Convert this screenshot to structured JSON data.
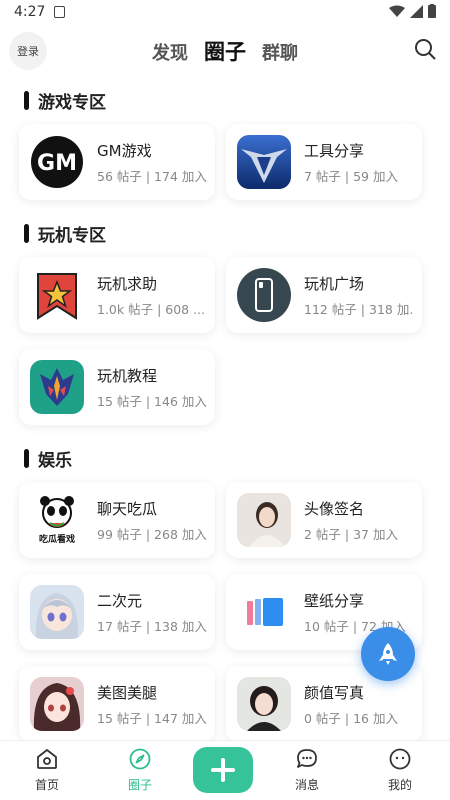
{
  "status": {
    "time": "4:27"
  },
  "header": {
    "login_label": "登录",
    "tabs": [
      "发现",
      "圈子",
      "群聊"
    ],
    "active_tab": 1
  },
  "sections": [
    {
      "title": "游戏专区"
    },
    {
      "title": "玩机专区"
    },
    {
      "title": "娱乐"
    }
  ],
  "cards": [
    {
      "name": "GM游戏",
      "stats": "56 帖子 | 174 加入",
      "icon": "gm-logo-icon"
    },
    {
      "name": "工具分享",
      "stats": "7 帖子 | 59 加入",
      "icon": "v-emblem-icon"
    },
    {
      "name": "玩机求助",
      "stats": "1.0k 帖子 | 608 ...",
      "icon": "star-flag-icon"
    },
    {
      "name": "玩机广场",
      "stats": "112 帖子 | 318 加...",
      "icon": "phone-icon"
    },
    {
      "name": "玩机教程",
      "stats": "15 帖子 | 146 加入",
      "icon": "magisk-mask-icon"
    },
    {
      "name": "聊天吃瓜",
      "stats": "99 帖子 | 268 加入",
      "icon": "panda-meme-icon",
      "icon_caption": "吃瓜看戏"
    },
    {
      "name": "头像签名",
      "stats": "2 帖子 | 37 加入",
      "icon": "portrait-photo-icon"
    },
    {
      "name": "二次元",
      "stats": "17 帖子 | 138 加入",
      "icon": "anime-girl-icon"
    },
    {
      "name": "壁纸分享",
      "stats": "10 帖子 | 72 加入",
      "icon": "wallpaper-icon"
    },
    {
      "name": "美图美腿",
      "stats": "15 帖子 | 147 加入",
      "icon": "anime-portrait-icon"
    },
    {
      "name": "颜值写真",
      "stats": "0 帖子 | 16 加入",
      "icon": "portrait-photo-icon"
    }
  ],
  "nav": {
    "items": [
      "首页",
      "圈子",
      "消息",
      "我的"
    ],
    "active": 1
  },
  "colors": {
    "accent": "#36c39a",
    "fab": "#3a8ee8"
  }
}
